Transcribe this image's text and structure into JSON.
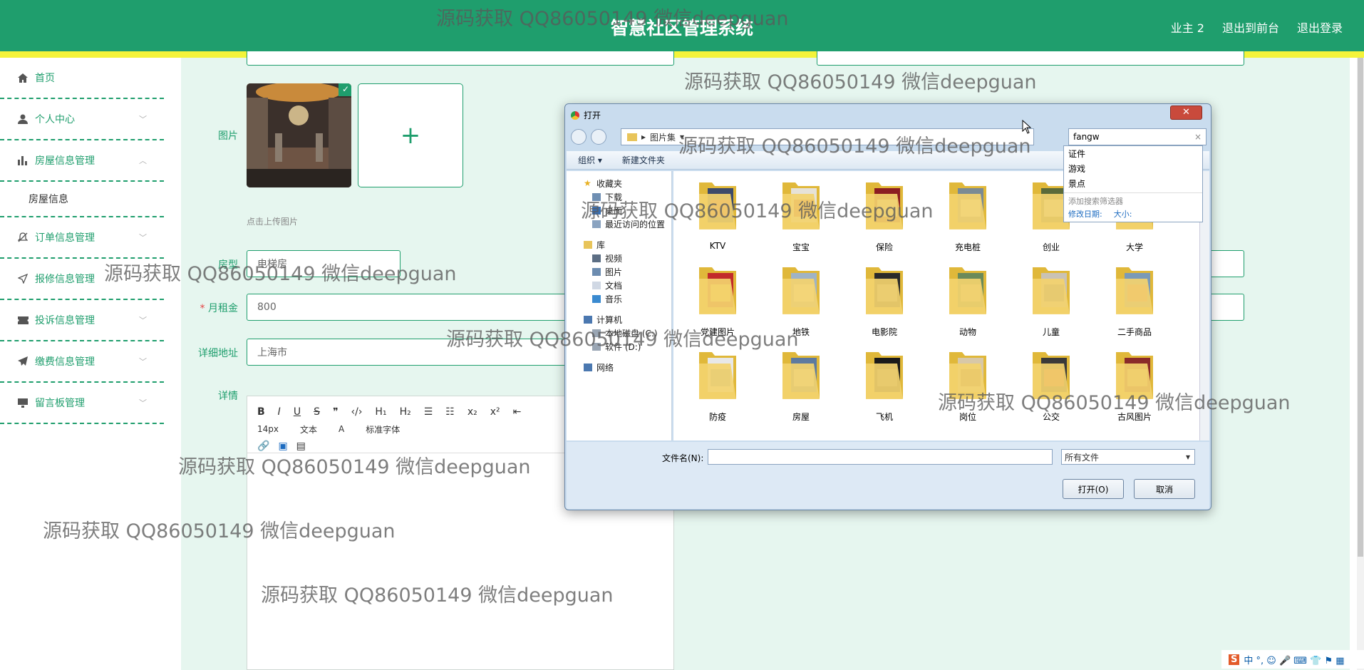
{
  "header": {
    "title": "智慧社区管理系统",
    "links": [
      "业主 2",
      "退出到前台",
      "退出登录"
    ]
  },
  "sidebar": {
    "items": [
      {
        "label": "首页",
        "icon": "home-icon"
      },
      {
        "label": "个人中心",
        "icon": "user-icon"
      },
      {
        "label": "房屋信息管理",
        "icon": "bar-chart-icon"
      },
      {
        "label": "订单信息管理",
        "icon": "bell-off-icon"
      },
      {
        "label": "报修信息管理",
        "icon": "send-icon"
      },
      {
        "label": "投诉信息管理",
        "icon": "ticket-icon"
      },
      {
        "label": "缴费信息管理",
        "icon": "paper-plane-icon"
      },
      {
        "label": "留言板管理",
        "icon": "monitor-icon"
      }
    ],
    "sub_item": "房屋信息"
  },
  "form": {
    "image_label": "图片",
    "upload_hint": "点击上传图片",
    "huxing_label": "房型",
    "huxing_value": "电梯房",
    "rent_label": "月租金",
    "rent_value": "800",
    "address_label": "详细地址",
    "address_value": "上海市",
    "detail_label": "详情",
    "font_size": "14px",
    "text_style": "文本",
    "font_family": "标准字体"
  },
  "dialog": {
    "title": "打开",
    "breadcrumb": "图片集",
    "search_value": "fangw",
    "organize": "组织 ▾",
    "new_folder": "新建文件夹",
    "tree": {
      "favorites": "收藏夹",
      "downloads": "下载",
      "desktop": "桌面",
      "recent": "最近访问的位置",
      "library": "库",
      "videos": "视频",
      "pictures": "图片",
      "documents": "文档",
      "music": "音乐",
      "computer": "计算机",
      "disk_c": "本地磁盘 (C:)",
      "disk_d": "软件 (D:)",
      "network": "网络"
    },
    "folders": [
      "KTV",
      "宝宝",
      "保险",
      "充电桩",
      "创业",
      "大学",
      "党建图片",
      "地铁",
      "电影院",
      "动物",
      "儿童",
      "二手商品",
      "防疫",
      "房屋",
      "飞机",
      "岗位",
      "公交",
      "古风图片"
    ],
    "suggestions": [
      "证件",
      "游戏",
      "景点"
    ],
    "add_filter": "添加搜索筛选器",
    "filter_date": "修改日期:",
    "filter_size": "大小:",
    "filename_label": "文件名(N):",
    "filetype": "所有文件",
    "open_btn": "打开(O)",
    "cancel_btn": "取消"
  },
  "watermark": "源码获取 QQ86050149 微信deepguan",
  "colors": {
    "primary": "#1f9e6d",
    "accent": "#f4f33a"
  }
}
